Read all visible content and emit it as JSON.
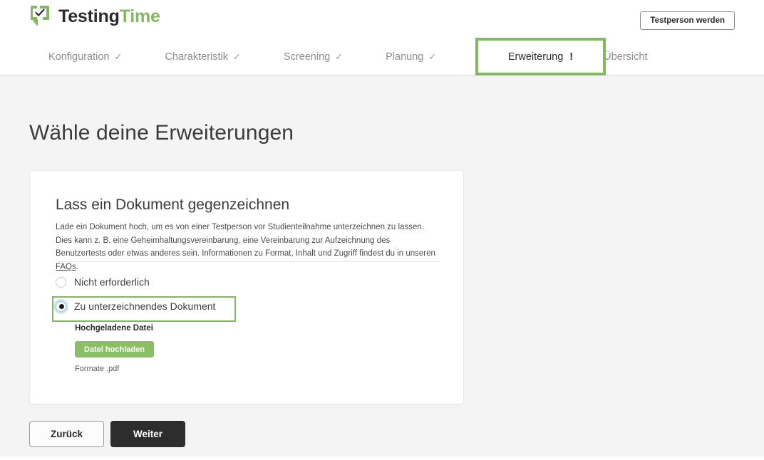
{
  "brand": {
    "name_part1": "Testing",
    "name_part2": "Time",
    "logo_icon": "speech-bubble-check-icon",
    "accent_green": "#82b861",
    "dark": "#2b2b2b"
  },
  "header": {
    "cta_label": "Testperson werden"
  },
  "nav": {
    "tabs": [
      {
        "label": "Konfiguration",
        "marker": "✓",
        "state": "completed"
      },
      {
        "label": "Charakteristik",
        "marker": "✓",
        "state": "completed"
      },
      {
        "label": "Screening",
        "marker": "✓",
        "state": "completed"
      },
      {
        "label": "Planung",
        "marker": "✓",
        "state": "completed"
      },
      {
        "label": "Erweiterung",
        "marker": "!",
        "state": "active"
      },
      {
        "label": "Übersicht",
        "marker": "",
        "state": "upcoming"
      }
    ],
    "highlight_color": "#82b861"
  },
  "main": {
    "page_title": "Wähle deine Erweiterungen",
    "card": {
      "title": "Lass ein Dokument gegenzeichnen",
      "description_before_link": "Lade ein Dokument hoch, um es von einer Testperson vor Studienteilnahme unterzeichnen zu lassen. Dies kann z. B. eine Geheimhaltungsvereinbarung, eine Vereinbarung zur Aufzeichnung des Benutzertests oder etwas anderes sein. Informationen zu Format, Inhalt und Zugriff findest du in unseren ",
      "description_link": "FAQs",
      "description_after_link": ".",
      "options": [
        {
          "label": "Nicht erforderlich",
          "selected": false
        },
        {
          "label": "Zu unterzeichnendes Dokument",
          "selected": true
        }
      ],
      "upload_section_label": "Hochgeladene Datei",
      "upload_button_label": "Datei hochladen",
      "formats_note": "Formate .pdf",
      "upload_button_color": "#8cbf63"
    }
  },
  "footer": {
    "back_label": "Zurück",
    "next_label": "Weiter"
  }
}
